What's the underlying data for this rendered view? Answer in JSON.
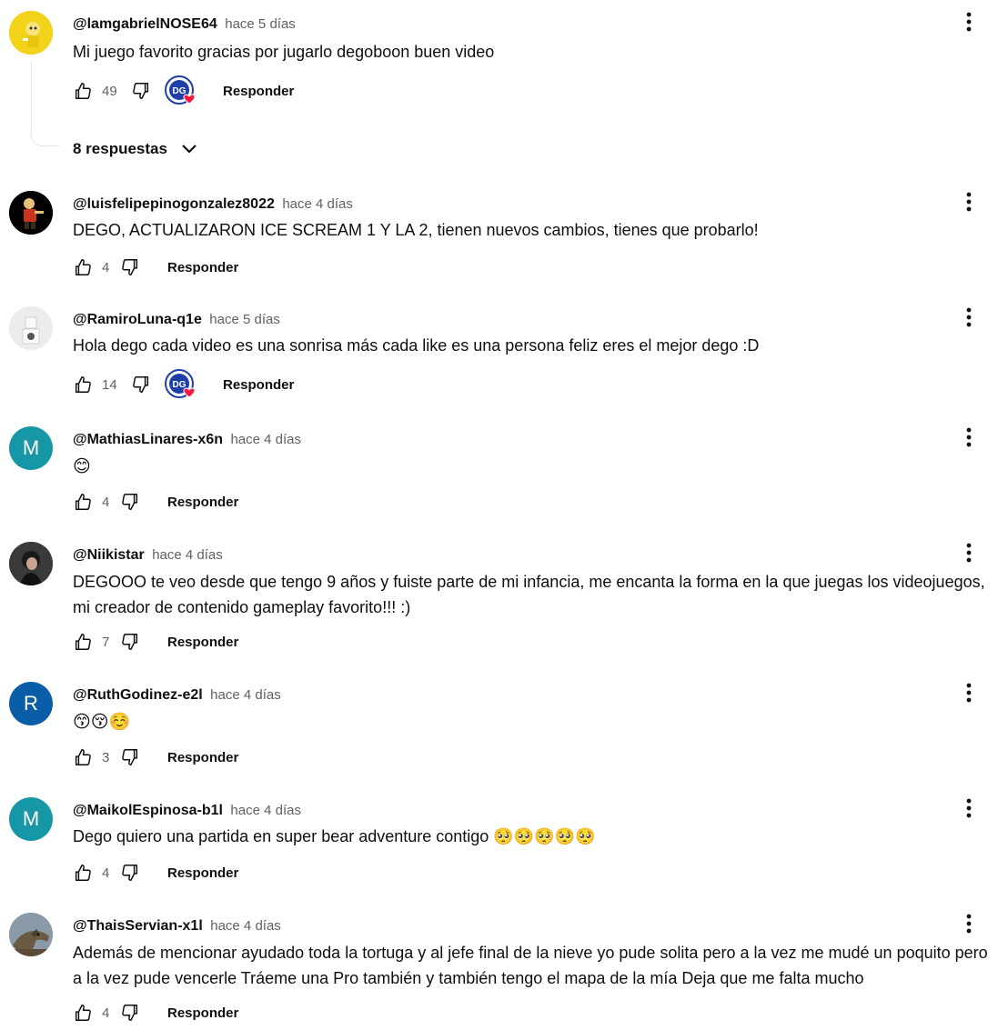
{
  "labels": {
    "reply": "Responder",
    "replies_toggle": "8 respuestas"
  },
  "colors": {
    "avatar_teal": "#1597a6",
    "avatar_blue": "#0a5ea8",
    "creator_badge": "#1e3fa8",
    "heart": "#ff1744"
  },
  "comments": [
    {
      "author": "@lamgabrielNOSE64",
      "time": "hace 5 días",
      "text": "Mi juego favorito gracias por jugarlo degoboon buen video",
      "likes": "49",
      "avatar_icon": "gold-character-avatar",
      "creator_heart": true,
      "has_replies": true
    },
    {
      "author": "@luisfelipepinogonzalez8022",
      "time": "hace 4 días",
      "text": "DEGO, ACTUALIZARON ICE SCREAM 1 Y LA 2, tienen nuevos cambios, tienes que probarlo!",
      "likes": "4",
      "avatar_icon": "character-avatar-black-bg"
    },
    {
      "author": "@RamiroLuna-q1e",
      "time": "hace 5 días",
      "text": "Hola dego cada video es una sonrisa más cada like es una persona feliz eres el mejor dego :D",
      "likes": "14",
      "avatar_icon": "grey-blocky-avatar",
      "creator_heart": true
    },
    {
      "author": "@MathiasLinares-x6n",
      "time": "hace 4 días",
      "text": "😊",
      "likes": "4",
      "avatar_letter": "M"
    },
    {
      "author": "@Niikistar",
      "time": "hace 4 días",
      "text": "DEGOOO te veo desde que tengo 9 años y fuiste parte de mi infancia, me encanta la forma en la que juegas los videojuegos, mi creador de contenido gameplay favorito!!! :)",
      "likes": "7",
      "avatar_icon": "dark-hair-photo-avatar"
    },
    {
      "author": "@RuthGodinez-e2l",
      "time": "hace 4 días",
      "text": "😙😚☺️",
      "likes": "3",
      "avatar_letter": "R"
    },
    {
      "author": "@MaikolEspinosa-b1l",
      "time": "hace 4 días",
      "text": "Dego quiero una partida en super bear adventure contigo 🥺🥺🥺🥺🥺",
      "likes": "4",
      "avatar_letter": "M"
    },
    {
      "author": "@ThaisServian-x1l",
      "time": "hace 4 días",
      "text": "Además de mencionar ayudado toda la tortuga y al jefe final de la nieve yo pude solita pero a la vez me mudé un poquito pero a la vez pude vencerle Tráeme una Pro también y también tengo el mapa de la mía Deja que me falta mucho",
      "likes": "4",
      "avatar_icon": "dinosaur-photo-avatar"
    }
  ]
}
